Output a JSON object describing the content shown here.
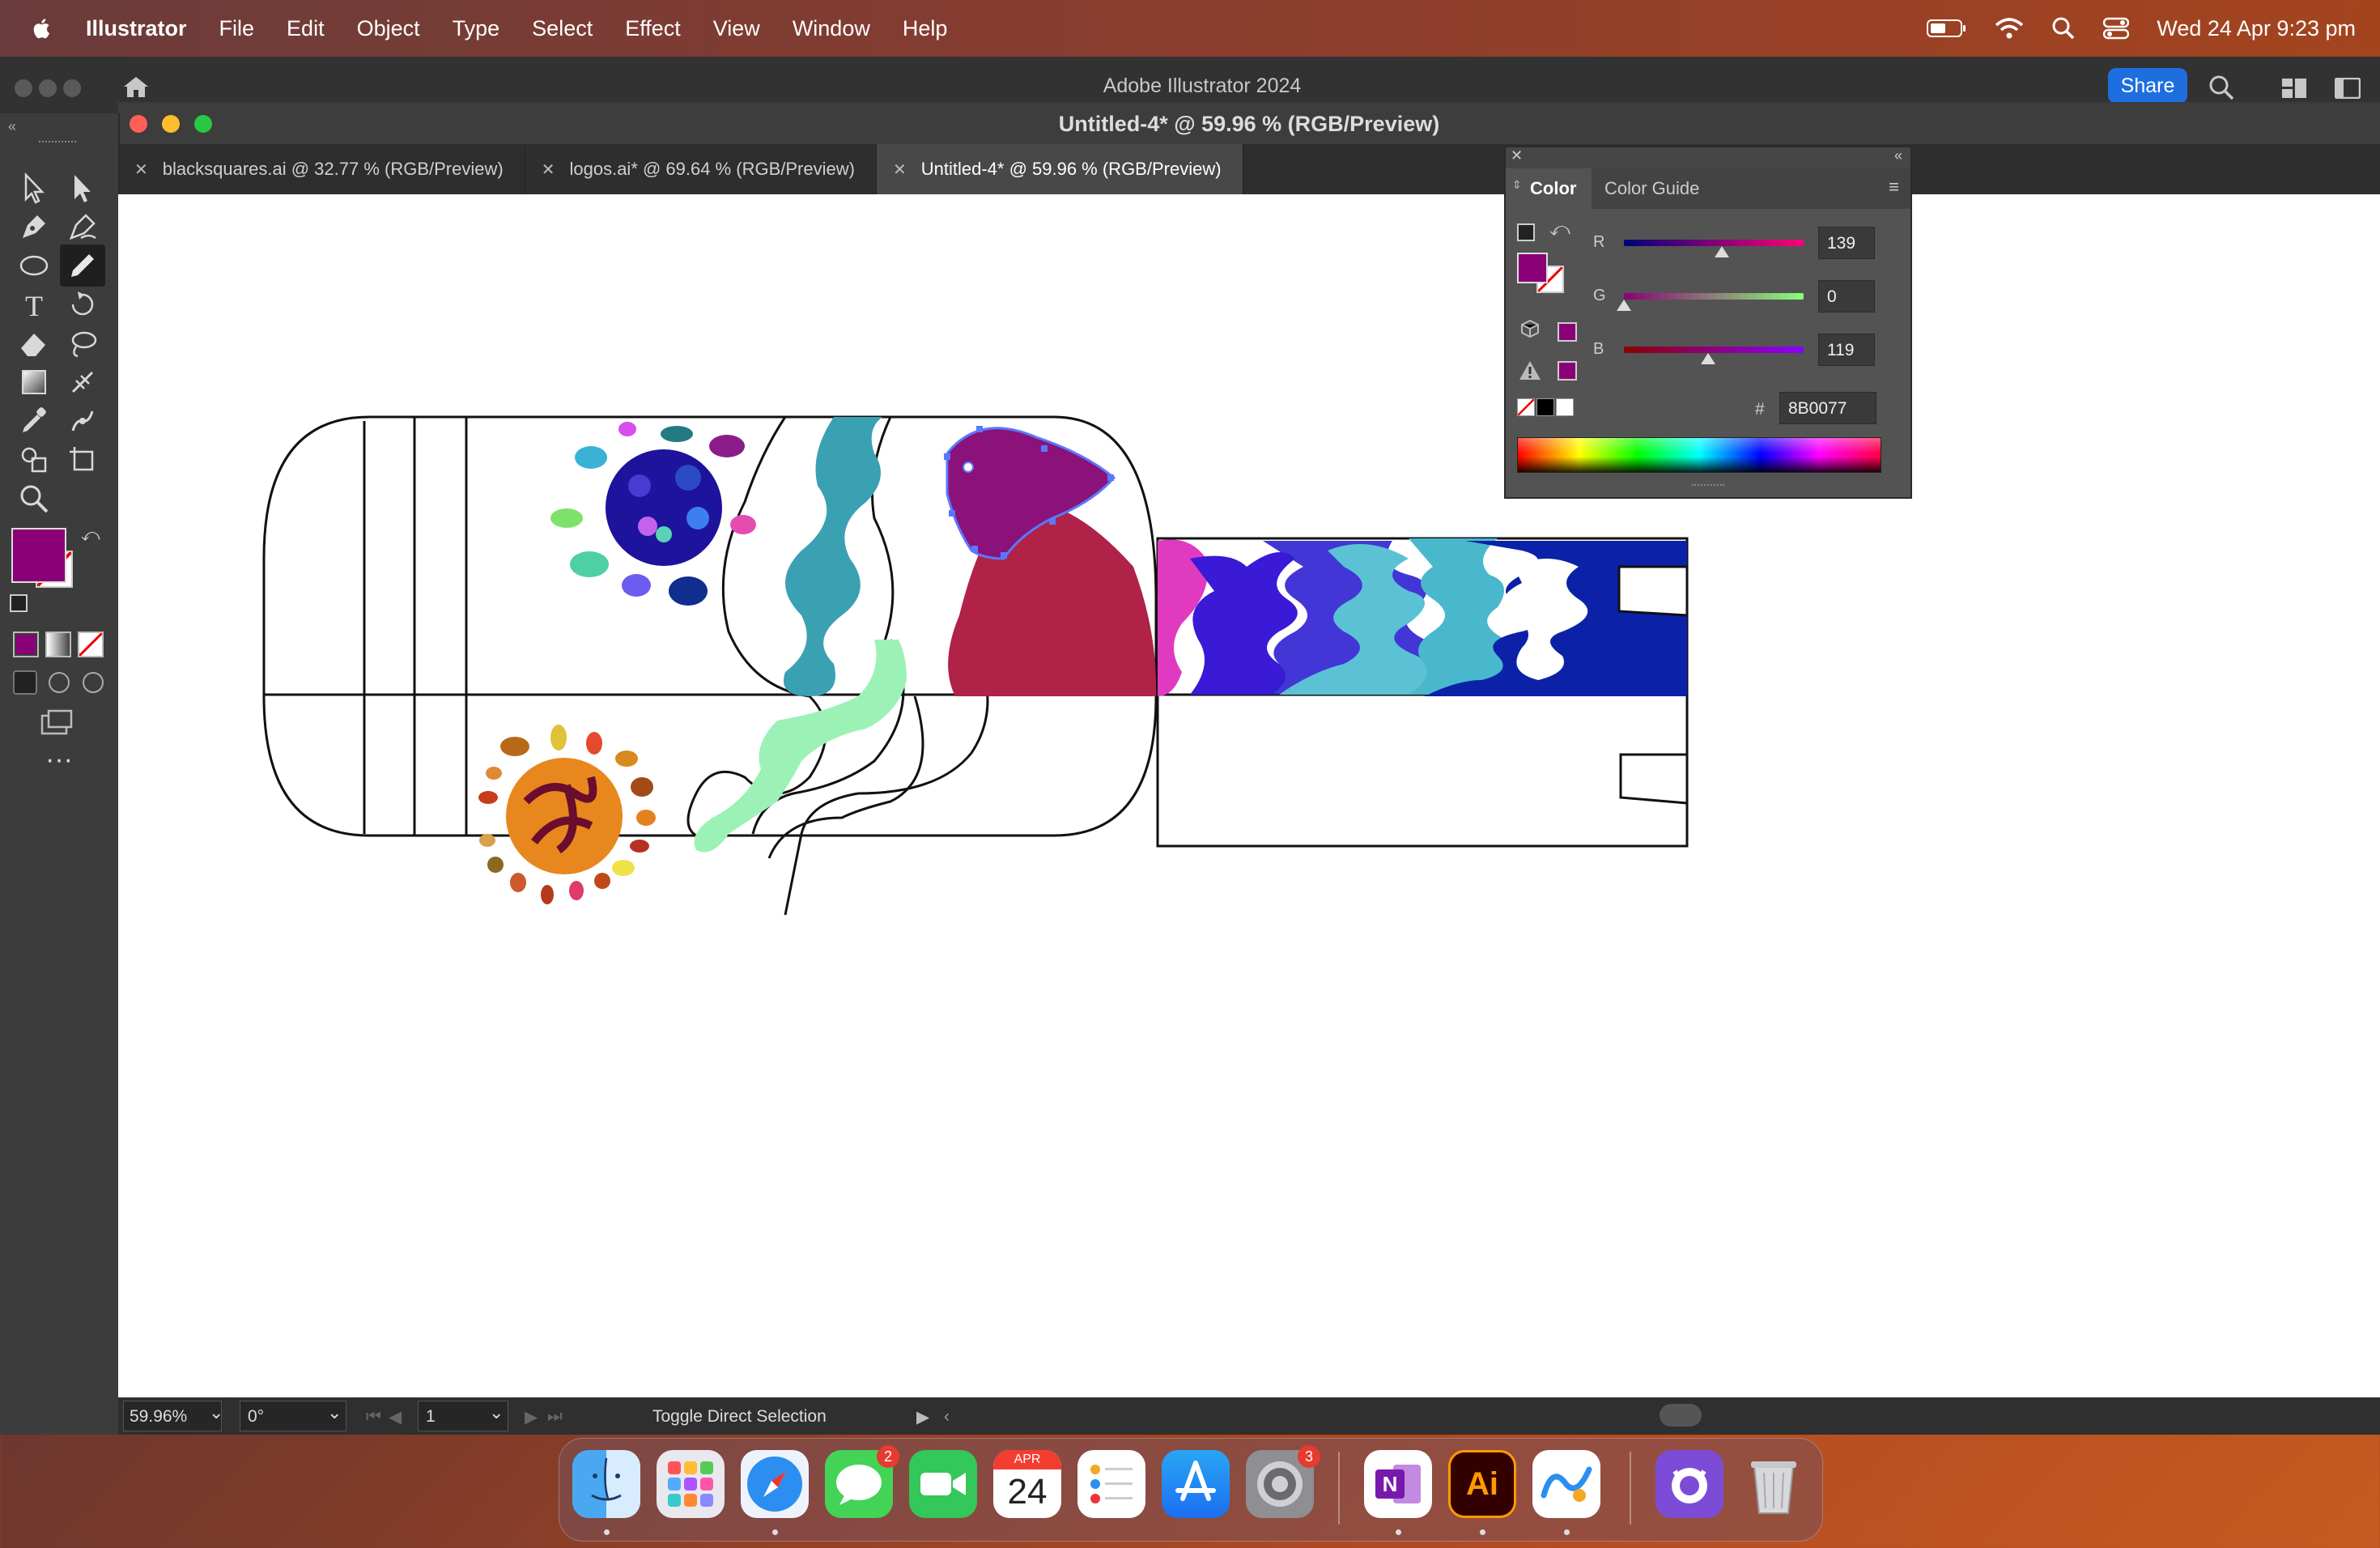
{
  "menubar": {
    "app_name": "Illustrator",
    "items": [
      "File",
      "Edit",
      "Object",
      "Type",
      "Select",
      "Effect",
      "View",
      "Window",
      "Help"
    ],
    "clock": "Wed 24 Apr  9:23 pm"
  },
  "app_window": {
    "title": "Adobe Illustrator 2024",
    "share_label": "Share"
  },
  "document": {
    "title": "Untitled-4* @ 59.96 % (RGB/Preview)",
    "tabs": [
      {
        "label": "blacksquares.ai @ 32.77 % (RGB/Preview)",
        "active": false
      },
      {
        "label": "logos.ai* @ 69.64 % (RGB/Preview)",
        "active": false
      },
      {
        "label": "Untitled-4* @ 59.96 % (RGB/Preview)",
        "active": true
      }
    ]
  },
  "toolbar": {
    "fill_color": "#8B0077",
    "tools": [
      "selection-tool",
      "direct-selection-tool",
      "pen-tool",
      "curvature-tool",
      "ellipse-tool",
      "pencil-tool",
      "type-tool",
      "rotate-tool",
      "eraser-tool",
      "lasso-tool",
      "gradient-tool",
      "width-tool",
      "eyedropper-tool",
      "puppet-warp-tool",
      "shape-builder-tool",
      "artboard-tool",
      "zoom-tool"
    ]
  },
  "color_panel": {
    "tabs": [
      "Color",
      "Color Guide"
    ],
    "active_tab": "Color",
    "channels": [
      {
        "label": "R",
        "value": "139",
        "fraction": 0.545
      },
      {
        "label": "G",
        "value": "0",
        "fraction": 0.0
      },
      {
        "label": "B",
        "value": "119",
        "fraction": 0.467
      }
    ],
    "hex_label": "#",
    "hex_value": "8B0077",
    "swatch_color": "#8B0077"
  },
  "status_bar": {
    "zoom": "59.96%",
    "rotation": "0°",
    "artboard": "1",
    "tool_hint": "Toggle Direct Selection"
  },
  "dock": {
    "apps": [
      "finder",
      "launchpad",
      "safari",
      "messages",
      "facetime",
      "calendar",
      "reminders",
      "app-store",
      "system-settings",
      "onenote",
      "illustrator",
      "freeform",
      "github-desktop",
      "trash"
    ],
    "messages_badge": "2",
    "settings_badge": "3",
    "calendar_month": "APR",
    "calendar_day": "24",
    "illustrator_label": "Ai"
  }
}
